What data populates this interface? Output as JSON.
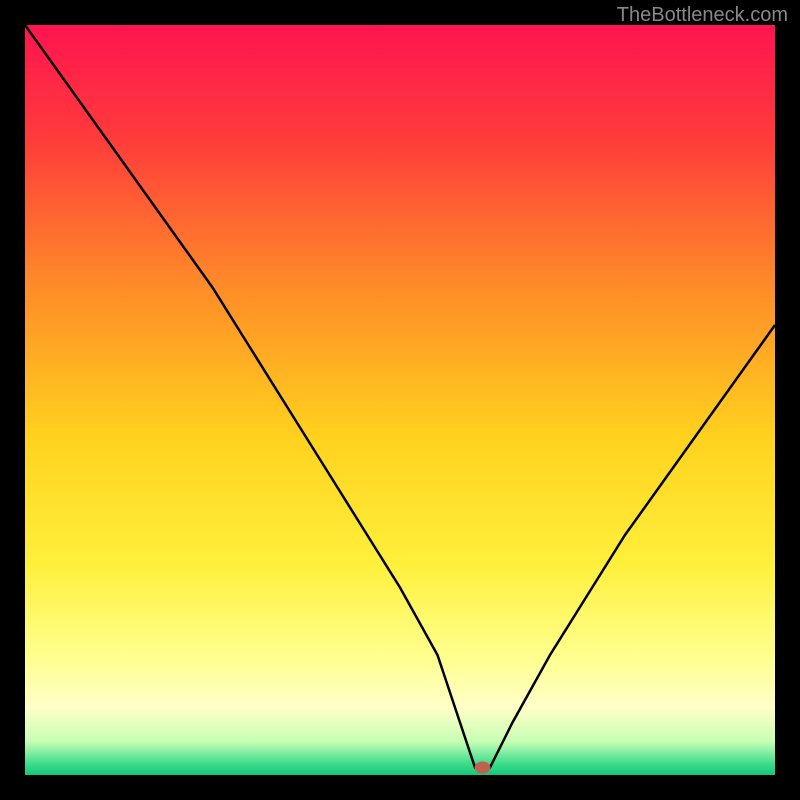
{
  "watermark": "TheBottleneck.com",
  "chart_data": {
    "type": "line",
    "title": "",
    "xlabel": "",
    "ylabel": "",
    "x": [
      0,
      5,
      10,
      15,
      20,
      25,
      30,
      35,
      40,
      45,
      50,
      55,
      58,
      60,
      62,
      65,
      70,
      75,
      80,
      85,
      90,
      95,
      100
    ],
    "values": [
      100,
      93,
      86,
      79,
      72,
      65,
      57,
      49,
      41,
      33,
      25,
      16,
      7,
      1,
      1,
      7,
      16,
      24,
      32,
      39,
      46,
      53,
      60
    ],
    "ylim": [
      0,
      100
    ],
    "xlim": [
      0,
      100
    ],
    "marker": {
      "x": 61,
      "y": 1
    },
    "gradient_stops": [
      {
        "offset": 0.0,
        "color": "#ff1450"
      },
      {
        "offset": 0.15,
        "color": "#ff3b3b"
      },
      {
        "offset": 0.35,
        "color": "#ff8c28"
      },
      {
        "offset": 0.55,
        "color": "#ffd21e"
      },
      {
        "offset": 0.72,
        "color": "#fff03c"
      },
      {
        "offset": 0.84,
        "color": "#ffff8c"
      },
      {
        "offset": 0.91,
        "color": "#ffffc8"
      },
      {
        "offset": 0.955,
        "color": "#c8ffb4"
      },
      {
        "offset": 0.985,
        "color": "#3cdc8c"
      },
      {
        "offset": 1.0,
        "color": "#14c878"
      }
    ]
  }
}
